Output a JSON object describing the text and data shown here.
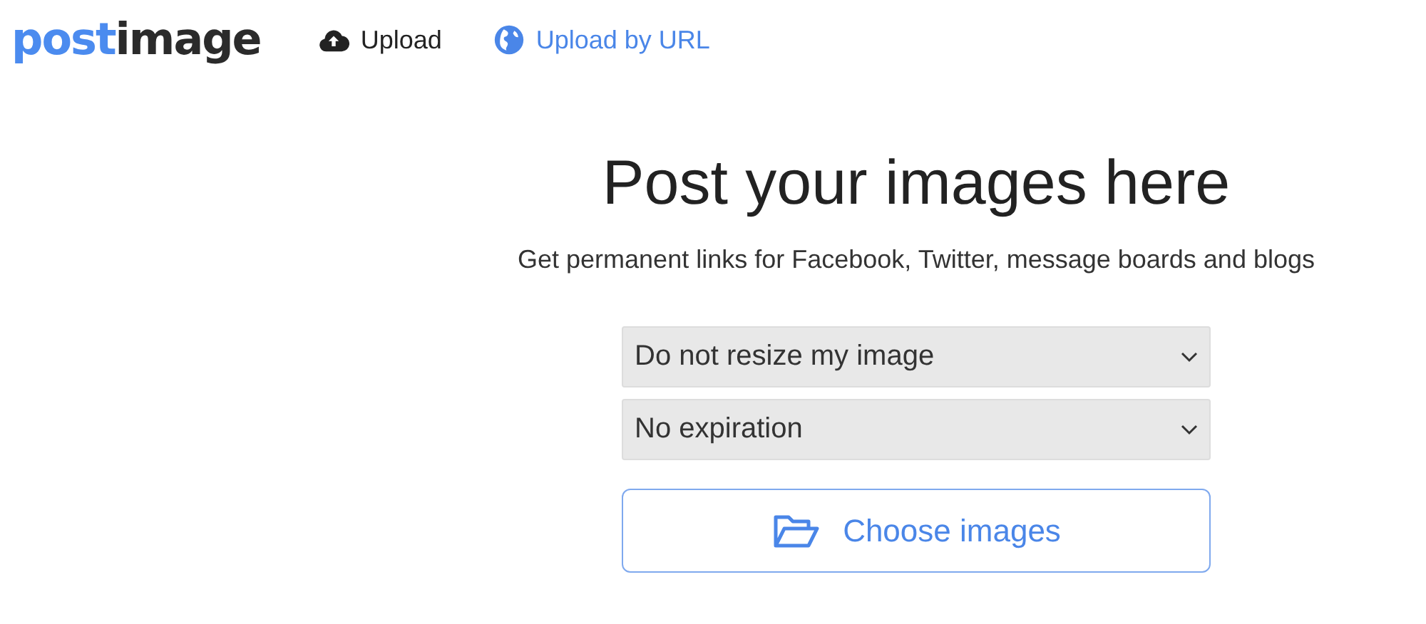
{
  "header": {
    "logo": {
      "part_1": "post",
      "part_2": "image"
    },
    "nav": [
      {
        "label": "Upload",
        "kind": "upload"
      },
      {
        "label": "Upload by URL",
        "kind": "url"
      }
    ]
  },
  "main": {
    "title": "Post your images here",
    "subtitle": "Get permanent links for Facebook, Twitter, message boards and blogs",
    "selects": [
      {
        "value": "Do not resize my image"
      },
      {
        "value": "No expiration"
      }
    ],
    "button": "Choose images"
  }
}
